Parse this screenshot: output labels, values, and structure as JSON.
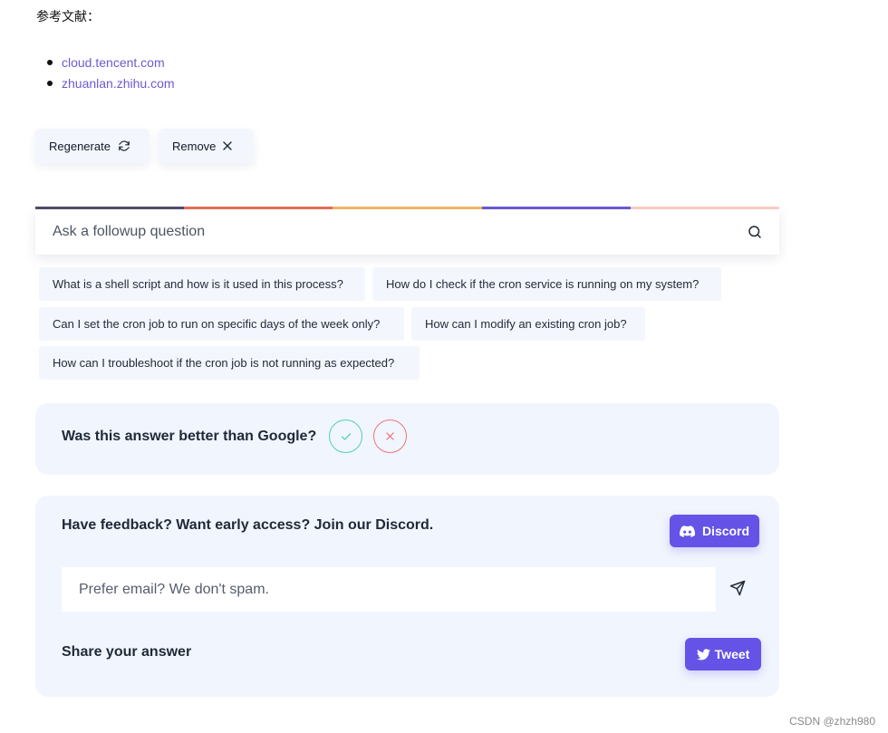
{
  "references": {
    "title": "参考文献：",
    "links": [
      "cloud.tencent.com",
      "zhuanlan.zhihu.com"
    ]
  },
  "actions": {
    "regenerate_label": "Regenerate",
    "remove_label": "Remove"
  },
  "color_bar": [
    "#4f4d69",
    "#e76f5b",
    "#f2b866",
    "#6a5bd6",
    "#ffcfc5"
  ],
  "followup": {
    "placeholder": "Ask a followup question",
    "suggestions": [
      "What is a shell script and how is it used in this process?",
      "How do I check if the cron service is running on my system?",
      "Can I set the cron job to run on specific days of the week only?",
      "How can I modify an existing cron job?",
      "How can I troubleshoot if the cron job is not running as expected?"
    ]
  },
  "google_feedback": {
    "question": "Was this answer better than Google?"
  },
  "community": {
    "discord_prompt": "Have feedback? Want early access? Join our Discord.",
    "discord_label": "Discord",
    "email_placeholder": "Prefer email? We don't spam.",
    "share_label": "Share your answer",
    "tweet_label": "Tweet"
  },
  "colors": {
    "accent": "#6453e6",
    "panel_bg": "#f1f5fd",
    "link": "#6d5bd0",
    "yes": "#4fd1b5",
    "no": "#f07575"
  },
  "watermark": "CSDN @zhzh980"
}
